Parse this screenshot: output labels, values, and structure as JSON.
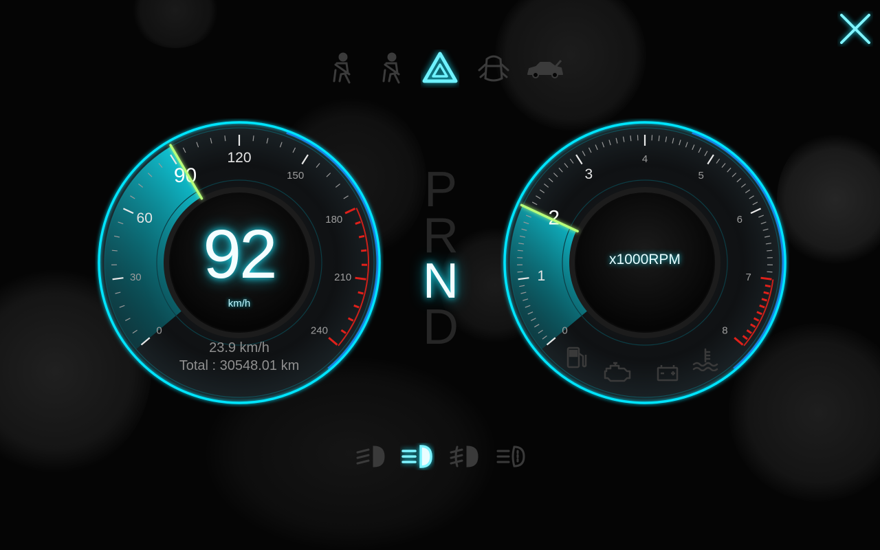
{
  "speedometer": {
    "speed": "92",
    "unit": "km/h",
    "speed_value": 92,
    "max": 240,
    "labels": [
      "0",
      "30",
      "60",
      "90",
      "120",
      "150",
      "180",
      "210",
      "240"
    ],
    "trip": "23.9 km/h",
    "total": "Total : 30548.01 km"
  },
  "tachometer": {
    "unit": "x1000RPM",
    "rpm_value": 2,
    "max": 8,
    "labels": [
      "0",
      "1",
      "2",
      "3",
      "4",
      "5",
      "6",
      "7",
      "8"
    ]
  },
  "gears": {
    "p": "P",
    "r": "R",
    "n": "N",
    "d": "D",
    "selected": "N"
  },
  "warning_icons": [
    "seatbelt-icon",
    "seatbelt-icon",
    "hazard-icon",
    "door-open-icon",
    "trunk-open-icon"
  ],
  "indicator_icons": [
    "fuel-icon",
    "engine-icon",
    "battery-icon",
    "coolant-temp-icon"
  ],
  "light_icons": [
    "low-beam-icon",
    "high-beam-icon",
    "fog-light-icon",
    "rear-fog-light-icon"
  ],
  "colors": {
    "accent": "#19d4e8",
    "glow": "#00e5ff",
    "redline": "#e0201a",
    "needle": "#b8ff7a",
    "inactive": "#3a3a3a"
  }
}
